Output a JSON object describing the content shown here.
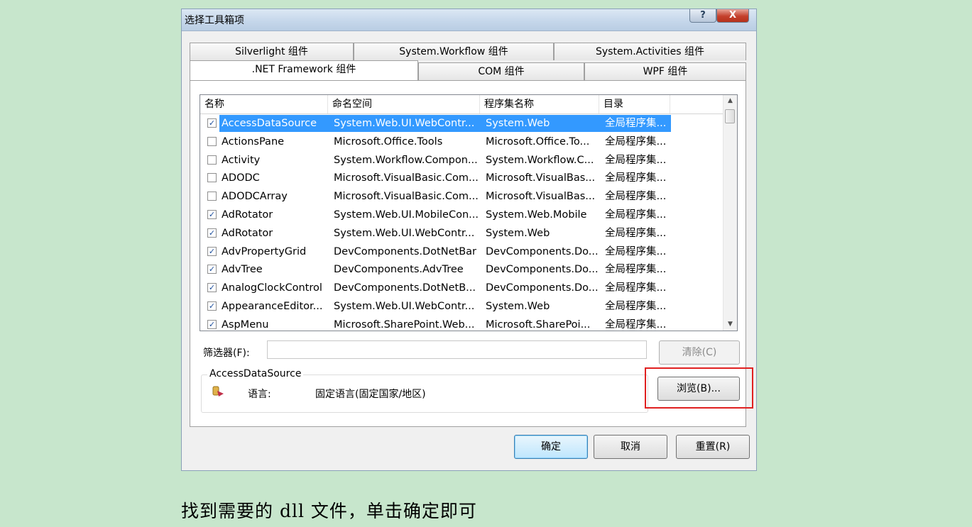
{
  "dialog": {
    "title": "选择工具箱项",
    "help_label": "?",
    "close_label": "X"
  },
  "tabs_row1": [
    "Silverlight 组件",
    "System.Workflow 组件",
    "System.Activities 组件"
  ],
  "tabs_row2": [
    ".NET Framework 组件",
    "COM 组件",
    "WPF 组件"
  ],
  "list": {
    "headers": [
      "名称",
      "命名空间",
      "程序集名称",
      "目录"
    ],
    "rows": [
      {
        "checked": true,
        "name": "AccessDataSource",
        "namespace": "System.Web.UI.WebContr...",
        "assembly": "System.Web",
        "dir": "全局程序集...",
        "selected": true
      },
      {
        "checked": false,
        "name": "ActionsPane",
        "namespace": "Microsoft.Office.Tools",
        "assembly": "Microsoft.Office.To...",
        "dir": "全局程序集..."
      },
      {
        "checked": false,
        "name": "Activity",
        "namespace": "System.Workflow.Compon...",
        "assembly": "System.Workflow.C...",
        "dir": "全局程序集..."
      },
      {
        "checked": false,
        "name": "ADODC",
        "namespace": "Microsoft.VisualBasic.Com...",
        "assembly": "Microsoft.VisualBas...",
        "dir": "全局程序集..."
      },
      {
        "checked": false,
        "name": "ADODCArray",
        "namespace": "Microsoft.VisualBasic.Com...",
        "assembly": "Microsoft.VisualBas...",
        "dir": "全局程序集..."
      },
      {
        "checked": true,
        "name": "AdRotator",
        "namespace": "System.Web.UI.MobileCon...",
        "assembly": "System.Web.Mobile",
        "dir": "全局程序集..."
      },
      {
        "checked": true,
        "name": "AdRotator",
        "namespace": "System.Web.UI.WebContr...",
        "assembly": "System.Web",
        "dir": "全局程序集..."
      },
      {
        "checked": true,
        "name": "AdvPropertyGrid",
        "namespace": "DevComponents.DotNetBar",
        "assembly": "DevComponents.Do...",
        "dir": "全局程序集..."
      },
      {
        "checked": true,
        "name": "AdvTree",
        "namespace": "DevComponents.AdvTree",
        "assembly": "DevComponents.Do...",
        "dir": "全局程序集..."
      },
      {
        "checked": true,
        "name": "AnalogClockControl",
        "namespace": "DevComponents.DotNetB...",
        "assembly": "DevComponents.Do...",
        "dir": "全局程序集..."
      },
      {
        "checked": true,
        "name": "AppearanceEditor...",
        "namespace": "System.Web.UI.WebContr...",
        "assembly": "System.Web",
        "dir": "全局程序集..."
      },
      {
        "checked": true,
        "name": "AspMenu",
        "namespace": "Microsoft.SharePoint.Web...",
        "assembly": "Microsoft.SharePoi...",
        "dir": "全局程序集..."
      }
    ]
  },
  "filter": {
    "label": "筛选器(F):",
    "value": "",
    "clear_label": "清除(C)"
  },
  "details": {
    "group_title": "AccessDataSource",
    "language_label": "语言:",
    "language_value": "固定语言(固定国家/地区)",
    "browse_label": "浏览(B)..."
  },
  "footer": {
    "ok_label": "确定",
    "cancel_label": "取消",
    "reset_label": "重置(R)"
  },
  "caption": "找到需要的 dll 文件，单击确定即可",
  "colors": {
    "page_bg": "#c7e6cc",
    "selection": "#3399ff",
    "highlight_box": "#e02020"
  }
}
